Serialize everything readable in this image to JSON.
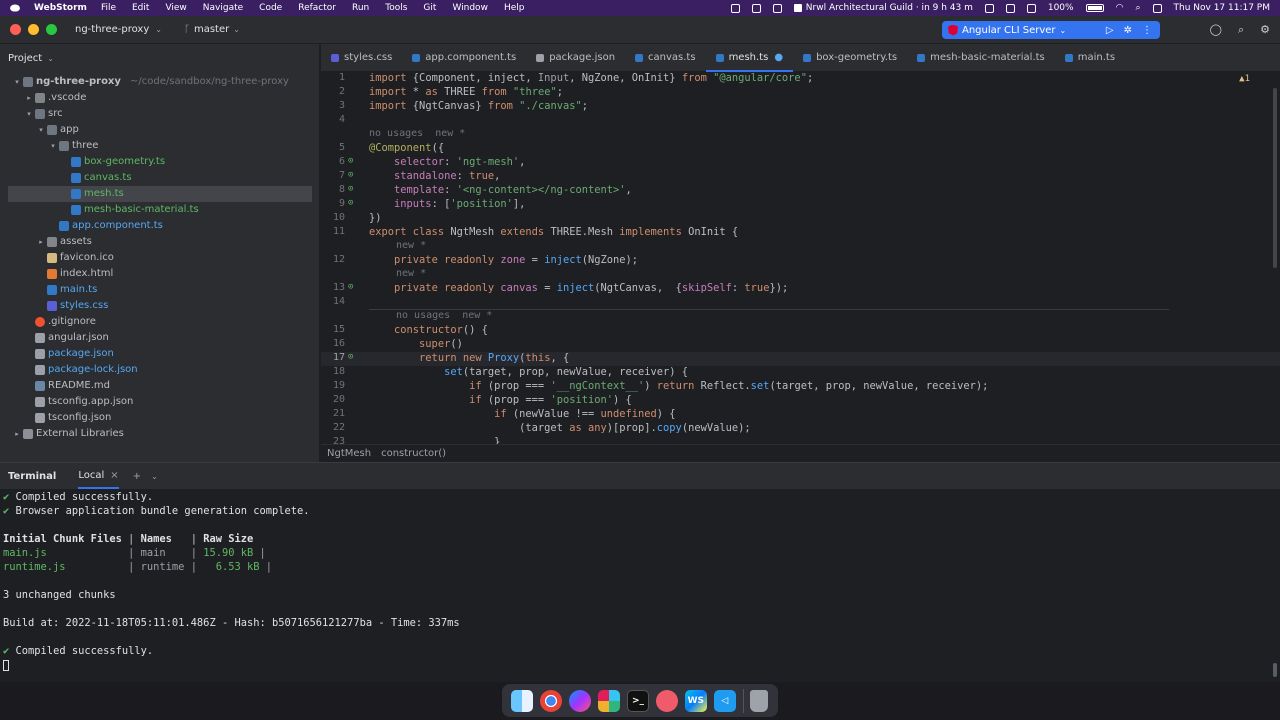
{
  "menubar": {
    "app_name": "WebStorm",
    "items": [
      "File",
      "Edit",
      "View",
      "Navigate",
      "Code",
      "Refactor",
      "Run",
      "Tools",
      "Git",
      "Window",
      "Help"
    ],
    "meeting": "Nrwl Architectural Guild · in 9 h 43 m",
    "battery": "100%",
    "datetime": "Thu Nov 17  11:17 PM"
  },
  "titlebar": {
    "project": "ng-three-proxy",
    "branch": "master",
    "run_config": "Angular CLI Server"
  },
  "project_panel": {
    "title": "Project",
    "tree": [
      {
        "label": "ng-three-proxy",
        "path": "~/code/sandbox/ng-three-proxy",
        "depth": 0,
        "type": "folder-open",
        "arrow": "▾",
        "color": "c-default",
        "bold": true
      },
      {
        "label": ".vscode",
        "depth": 1,
        "type": "folder",
        "arrow": "▸",
        "color": "c-default"
      },
      {
        "label": "src",
        "depth": 1,
        "type": "folder-open",
        "arrow": "▾",
        "color": "c-default"
      },
      {
        "label": "app",
        "depth": 2,
        "type": "folder-open",
        "arrow": "▾",
        "color": "c-default"
      },
      {
        "label": "three",
        "depth": 3,
        "type": "folder-open",
        "arrow": "▾",
        "color": "c-default"
      },
      {
        "label": "box-geometry.ts",
        "depth": 4,
        "type": "ts",
        "color": "c-green"
      },
      {
        "label": "canvas.ts",
        "depth": 4,
        "type": "ts",
        "color": "c-green"
      },
      {
        "label": "mesh.ts",
        "depth": 4,
        "type": "ts",
        "color": "c-green",
        "selected": true
      },
      {
        "label": "mesh-basic-material.ts",
        "depth": 4,
        "type": "ts",
        "color": "c-green"
      },
      {
        "label": "app.component.ts",
        "depth": 3,
        "type": "ts",
        "color": "c-blue"
      },
      {
        "label": "assets",
        "depth": 2,
        "type": "folder",
        "arrow": "▸",
        "color": "c-default"
      },
      {
        "label": "favicon.ico",
        "depth": 2,
        "type": "ico",
        "color": "c-default"
      },
      {
        "label": "index.html",
        "depth": 2,
        "type": "html",
        "color": "c-default"
      },
      {
        "label": "main.ts",
        "depth": 2,
        "type": "ts",
        "color": "c-blue"
      },
      {
        "label": "styles.css",
        "depth": 2,
        "type": "css",
        "color": "c-blue"
      },
      {
        "label": ".gitignore",
        "depth": 1,
        "type": "git",
        "color": "c-default"
      },
      {
        "label": "angular.json",
        "depth": 1,
        "type": "json",
        "color": "c-default"
      },
      {
        "label": "package.json",
        "depth": 1,
        "type": "json",
        "color": "c-blue"
      },
      {
        "label": "package-lock.json",
        "depth": 1,
        "type": "json",
        "color": "c-blue"
      },
      {
        "label": "README.md",
        "depth": 1,
        "type": "md",
        "color": "c-default"
      },
      {
        "label": "tsconfig.app.json",
        "depth": 1,
        "type": "json",
        "color": "c-default"
      },
      {
        "label": "tsconfig.json",
        "depth": 1,
        "type": "json",
        "color": "c-default"
      },
      {
        "label": "External Libraries",
        "depth": 0,
        "type": "lib",
        "arrow": "▸",
        "color": "c-default"
      }
    ]
  },
  "editor_tabs": [
    {
      "label": "styles.css",
      "type": "css"
    },
    {
      "label": "app.component.ts",
      "type": "ts"
    },
    {
      "label": "package.json",
      "type": "json"
    },
    {
      "label": "canvas.ts",
      "type": "ts"
    },
    {
      "label": "mesh.ts",
      "type": "ts",
      "active": true,
      "modified": true
    },
    {
      "label": "box-geometry.ts",
      "type": "ts"
    },
    {
      "label": "mesh-basic-material.ts",
      "type": "ts"
    },
    {
      "label": "main.ts",
      "type": "ts"
    }
  ],
  "editor": {
    "warning_count": "▲1",
    "hints": {
      "h1": "no usages  new *",
      "h2": "new *",
      "h3": "new *",
      "h4": "no usages  new *"
    },
    "line_numbers": [
      "1",
      "2",
      "3",
      "4",
      "5",
      "6",
      "7",
      "8",
      "9",
      "10",
      "11",
      "12",
      "13",
      "14",
      "15",
      "16",
      "17",
      "18",
      "19",
      "20",
      "21",
      "22",
      "23"
    ]
  },
  "breadcrumbs": [
    "NgtMesh",
    "constructor()"
  ],
  "terminal": {
    "title": "Terminal",
    "tab": "Local",
    "lines": {
      "l1": "Compiled successfully.",
      "l2": "Browser application bundle generation complete.",
      "h1": "Initial Chunk Files",
      "h2": "Names",
      "h3": "Raw Size",
      "r1a": "main.js",
      "r1b": "main",
      "r1c": "15.90 kB",
      "r2a": "runtime.js",
      "r2b": "runtime",
      "r2c": "6.53 kB",
      "unchanged": "3 unchanged chunks",
      "build": "Build at: 2022-11-18T05:11:01.486Z - Hash: b5071656121277ba - Time: 337ms",
      "l3": "Compiled successfully."
    }
  }
}
